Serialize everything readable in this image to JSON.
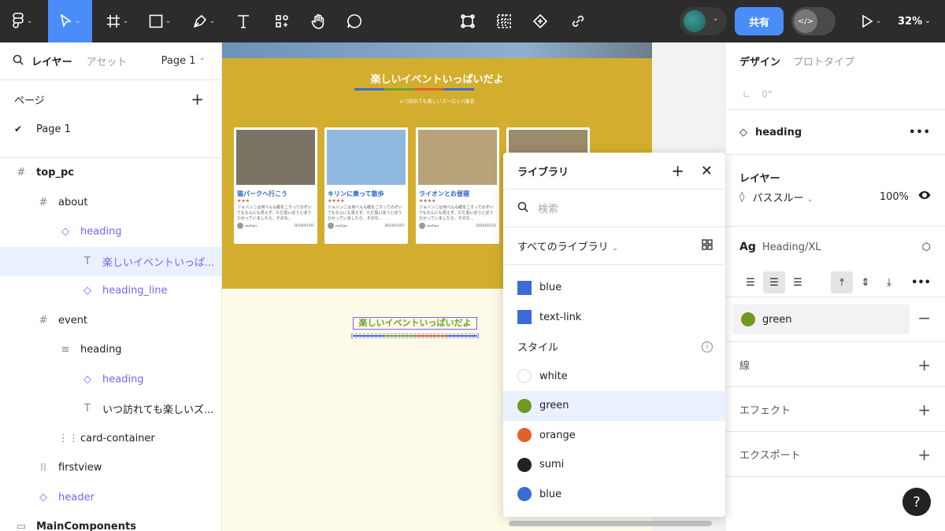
{
  "toolbar": {
    "share_label": "共有",
    "zoom": "32%",
    "dev_mode_icon": "</>",
    "icons": [
      "figma-menu-icon",
      "move-tool-icon",
      "frame-tool-icon",
      "rectangle-tool-icon",
      "pen-tool-icon",
      "text-tool-icon",
      "resources-icon",
      "hand-tool-icon",
      "comment-icon",
      "component-icon",
      "grid-icon",
      "instance-icon",
      "link-icon",
      "play-icon"
    ]
  },
  "left_panel": {
    "tab_layers": "レイヤー",
    "tab_assets": "アセット",
    "page_selector": "Page 1",
    "pages_heading": "ページ",
    "pages": [
      "Page 1"
    ],
    "layers": [
      {
        "label": "top_pc",
        "icon": "#",
        "indent": 0,
        "type": "frame"
      },
      {
        "label": "about",
        "icon": "#",
        "indent": 1,
        "type": "frame"
      },
      {
        "label": "heading",
        "icon": "◇",
        "indent": 2,
        "type": "component"
      },
      {
        "label": "楽しいイベントいっぱ...",
        "icon": "T",
        "indent": 3,
        "type": "text-selected"
      },
      {
        "label": "heading_line",
        "icon": "◇",
        "indent": 3,
        "type": "component"
      },
      {
        "label": "event",
        "icon": "#",
        "indent": 1,
        "type": "frame"
      },
      {
        "label": "heading",
        "icon": "≡",
        "indent": 2,
        "type": "autolayout"
      },
      {
        "label": "heading",
        "icon": "◇",
        "indent": 3,
        "type": "component"
      },
      {
        "label": "いつ訪れても楽しいズ...",
        "icon": "T",
        "indent": 3,
        "type": "text"
      },
      {
        "label": "card-container",
        "icon": "⋮⋮",
        "indent": 2,
        "type": "grid"
      },
      {
        "label": "firstview",
        "icon": "⁞⁞",
        "indent": 1,
        "type": "frame"
      },
      {
        "label": "header",
        "icon": "◇",
        "indent": 1,
        "type": "component"
      },
      {
        "label": "MainComponents",
        "icon": "▭",
        "indent": 0,
        "type": "section"
      }
    ]
  },
  "canvas": {
    "about_title": "楽しいイベントいっぱいだよ",
    "about_subtitle": "いつ訪れても楽しいズーロッパ東京",
    "cards": [
      {
        "title": "猫パークへ行こう",
        "stars": "★★★",
        "body": "ジョバンニは何べんも眼をこすってのぞいてもなんにも見えず、ただ黒いぼうとぼうひかっていましたら、そのな...",
        "author": "mellan",
        "date": "2024/01/01",
        "photo_color": "#7b7466"
      },
      {
        "title": "キリンに乗って散歩",
        "stars": "★★★★",
        "body": "ジョバンニは何べんも眼をこすってのぞいてもなんにも見えず、ただ黒いぼうとぼうひかっていましたら、そのな...",
        "author": "mellan",
        "date": "2024/01/07",
        "photo_color": "#8fb9de"
      },
      {
        "title": "ライオンとお昼寝",
        "stars": "★★★★",
        "body": "ジョバンニは何べんも眼をこすってのぞいてもなんにも見えず、ただ黒いぼうとぼうひかっていましたら、そのな...",
        "author": "mellan",
        "date": "2024/01/21",
        "photo_color": "#b8a27a"
      },
      {
        "title": "",
        "stars": "",
        "body": "",
        "author": "",
        "date": "",
        "photo_color": "#9a8b6a"
      }
    ],
    "event_title": "楽しいイベントいっぱいだよ"
  },
  "library": {
    "title": "ライブラリ",
    "search_placeholder": "検索",
    "filter_label": "すべてのライブラリ",
    "variables": [
      {
        "name": "blue",
        "color": "#3b6bd6"
      },
      {
        "name": "text-link",
        "color": "#3b6bd6"
      }
    ],
    "styles_heading": "スタイル",
    "styles": [
      {
        "name": "white",
        "color": "#ffffff",
        "highlighted": false
      },
      {
        "name": "green",
        "color": "#6f9a1f",
        "highlighted": true
      },
      {
        "name": "orange",
        "color": "#e0612a",
        "highlighted": false
      },
      {
        "name": "sumi",
        "color": "#222222",
        "highlighted": false
      },
      {
        "name": "blue",
        "color": "#3b6bd6",
        "highlighted": false
      }
    ]
  },
  "right_panel": {
    "tab_design": "デザイン",
    "tab_prototype": "プロトタイプ",
    "rotation": "0°",
    "component_name": "heading",
    "layer_heading": "レイヤー",
    "blend_mode": "パススルー",
    "opacity": "100%",
    "text_style_prefix": "Ag",
    "text_style": "Heading/XL",
    "fill_name": "green",
    "fill_color": "#6f9a1f",
    "stroke_label": "線",
    "effects_label": "エフェクト",
    "export_label": "エクスポート",
    "help": "?"
  },
  "colors": {
    "accent": "#4a8df8",
    "selection": "#7b61ff",
    "toolbar_bg": "#2c2c2c"
  }
}
